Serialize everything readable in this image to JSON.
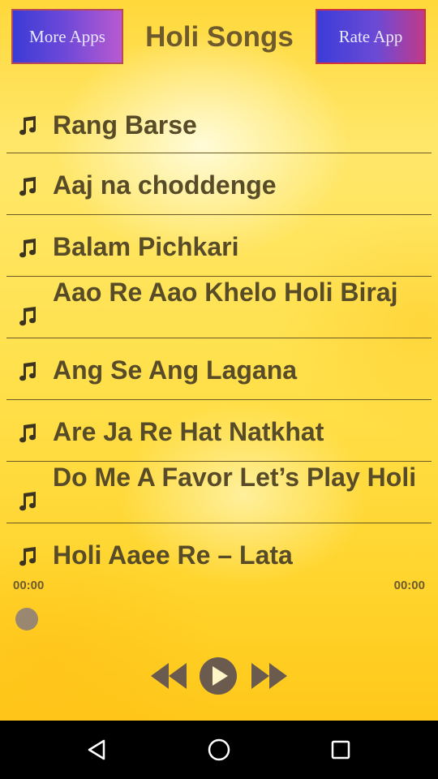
{
  "header": {
    "more_apps_label": "More Apps",
    "title": "Holi Songs",
    "rate_app_label": "Rate App"
  },
  "songs": [
    {
      "title": "Rang Barse"
    },
    {
      "title": "Aaj na choddenge"
    },
    {
      "title": "Balam Pichkari"
    },
    {
      "title": "Aao Re Aao Khelo Holi Biraj Me"
    },
    {
      "title": "Ang Se Ang Lagana"
    },
    {
      "title": "Are Ja Re Hat Natkhat"
    },
    {
      "title": "Do Me A Favor Let’s Play Holi"
    },
    {
      "title": "Holi Aaee Re – Lata"
    }
  ],
  "player": {
    "elapsed": "00:00",
    "duration": "00:00",
    "progress": 0,
    "controls": {
      "rewind_icon": "rewind-icon",
      "play_icon": "play-icon",
      "forward_icon": "fast-forward-icon"
    }
  },
  "navbar": {
    "back_icon": "back-icon",
    "home_icon": "home-icon",
    "recent_icon": "recent-apps-icon"
  },
  "colors": {
    "background": "#ffe14e",
    "button_gradient_start": "#3b3bd6",
    "button_gradient_end": "#b85ad0",
    "text": "#574b28",
    "divider": "#6c5a26"
  }
}
